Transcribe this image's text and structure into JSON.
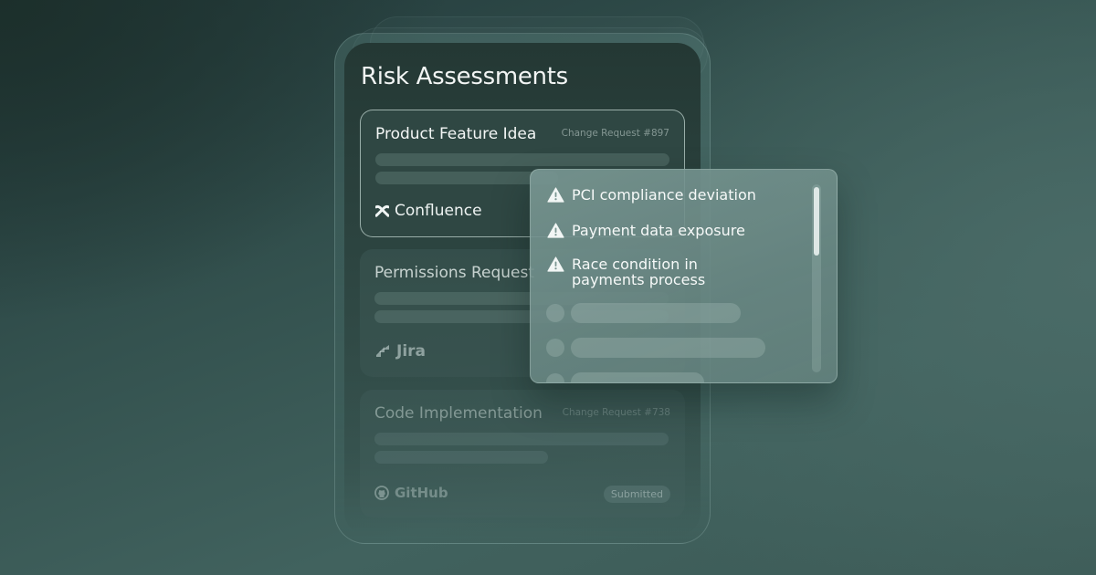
{
  "page": {
    "title": "Risk Assessments"
  },
  "cards": [
    {
      "title": "Product Feature Idea",
      "reference": "Change Request #897",
      "source": "Confluence",
      "source_icon": "confluence-icon"
    },
    {
      "title": "Permissions Request",
      "reference": "",
      "source": "Jira",
      "source_icon": "jira-icon"
    },
    {
      "title": "Code Implementation",
      "reference": "Change Request #738",
      "source": "GitHub",
      "source_icon": "github-icon",
      "status": "Submitted"
    }
  ],
  "risks": {
    "items": [
      {
        "label": "PCI compliance deviation",
        "icon": "warning-icon"
      },
      {
        "label": "Payment data exposure",
        "icon": "warning-icon"
      },
      {
        "label": "Race condition in payments process",
        "label_line1": "Race condition in",
        "label_line2": "payments process",
        "icon": "warning-icon"
      }
    ]
  },
  "colors": {
    "background": "#2f4b48",
    "card_active_border": "#d2e6e1",
    "popover": "#7a9692"
  }
}
